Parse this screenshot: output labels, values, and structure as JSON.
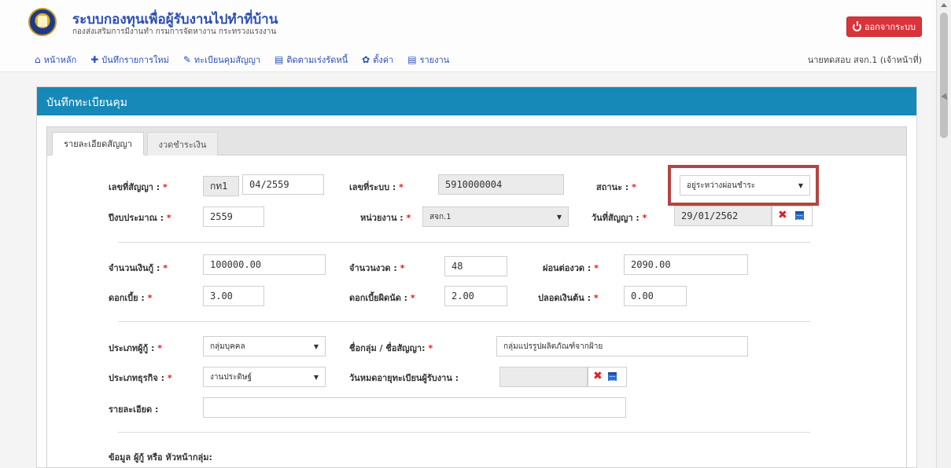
{
  "header": {
    "title": "ระบบกองทุนเพื่อผู้รับงานไปทำที่บ้าน",
    "subtitle": "กองส่งเสริมการมีงานทำ กรมการจัดหางาน กระทรวงแรงงาน",
    "logout_label": "ออกจากระบบ",
    "user_label": "นายทดสอบ สจก.1 (เจ้าหน้าที่)"
  },
  "nav": {
    "items": [
      {
        "label": "หน้าหลัก",
        "icon": "home-icon"
      },
      {
        "label": "บันทึกรายการใหม่",
        "icon": "plus-icon"
      },
      {
        "label": "ทะเบียนคุมสัญญา",
        "icon": "edit-icon"
      },
      {
        "label": "ติดตามเร่งรัดหนี้",
        "icon": "list-icon"
      },
      {
        "label": "ตั้งค่า",
        "icon": "gear-icon"
      },
      {
        "label": "รายงาน",
        "icon": "list-icon"
      }
    ]
  },
  "panel": {
    "title": "บันทึกทะเบียนคุม",
    "tabs": [
      {
        "label": "รายละเอียดสัญญา",
        "active": true
      },
      {
        "label": "งวดชำระเงิน",
        "active": false
      }
    ]
  },
  "form": {
    "contract_no": {
      "label": "เลขที่สัญญา :",
      "prefix": "กท1",
      "value": "04/2559"
    },
    "system_no": {
      "label": "เลขที่ระบบ :",
      "value": "5910000004"
    },
    "status": {
      "label": "สถานะ :",
      "value": "อยู่ระหว่างผ่อนชำระ"
    },
    "budget_year": {
      "label": "ปีงบประมาณ :",
      "value": "2559"
    },
    "unit": {
      "label": "หน่วยงาน :",
      "value": "สจก.1"
    },
    "contract_date": {
      "label": "วันที่สัญญา :",
      "value": "29/01/2562"
    },
    "loan_amount": {
      "label": "จำนวนเงินกู้ :",
      "value": "100000.00"
    },
    "installments": {
      "label": "จำนวนงวด :",
      "value": "48"
    },
    "per_installment": {
      "label": "ผ่อนต่องวด :",
      "value": "2090.00"
    },
    "interest": {
      "label": "ดอกเบี้ย :",
      "value": "3.00"
    },
    "penalty_interest": {
      "label": "ดอกเบี้ยผิดนัด :",
      "value": "2.00"
    },
    "principal_free": {
      "label": "ปลอดเงินต้น :",
      "value": "0.00"
    },
    "borrower_type": {
      "label": "ประเภทผู้กู้ :",
      "value": "กลุ่มบุคคล"
    },
    "group_name": {
      "label": "ชื่อกลุ่ม / ชื่อสัญญา:",
      "value": "กลุ่มแปรรูปผลิตภัณฑ์จากฝ้าย"
    },
    "business_type": {
      "label": "ประเภทธุรกิจ :",
      "value": "งานประดิษฐ์"
    },
    "registration_expiry": {
      "label": "วันหมดอายุทะเบียนผู้รับงาน :",
      "value": ""
    },
    "details": {
      "label": "รายละเอียด :",
      "value": ""
    },
    "borrower_section": "ข้อมูล ผู้กู้ หรือ หัวหน้ากลุ่ม:",
    "required_mark": "*"
  },
  "colors": {
    "brand_blue": "#1689b8",
    "logout_red": "#d9343b",
    "highlight": "#b54444",
    "link_blue": "#2a4fb5"
  }
}
